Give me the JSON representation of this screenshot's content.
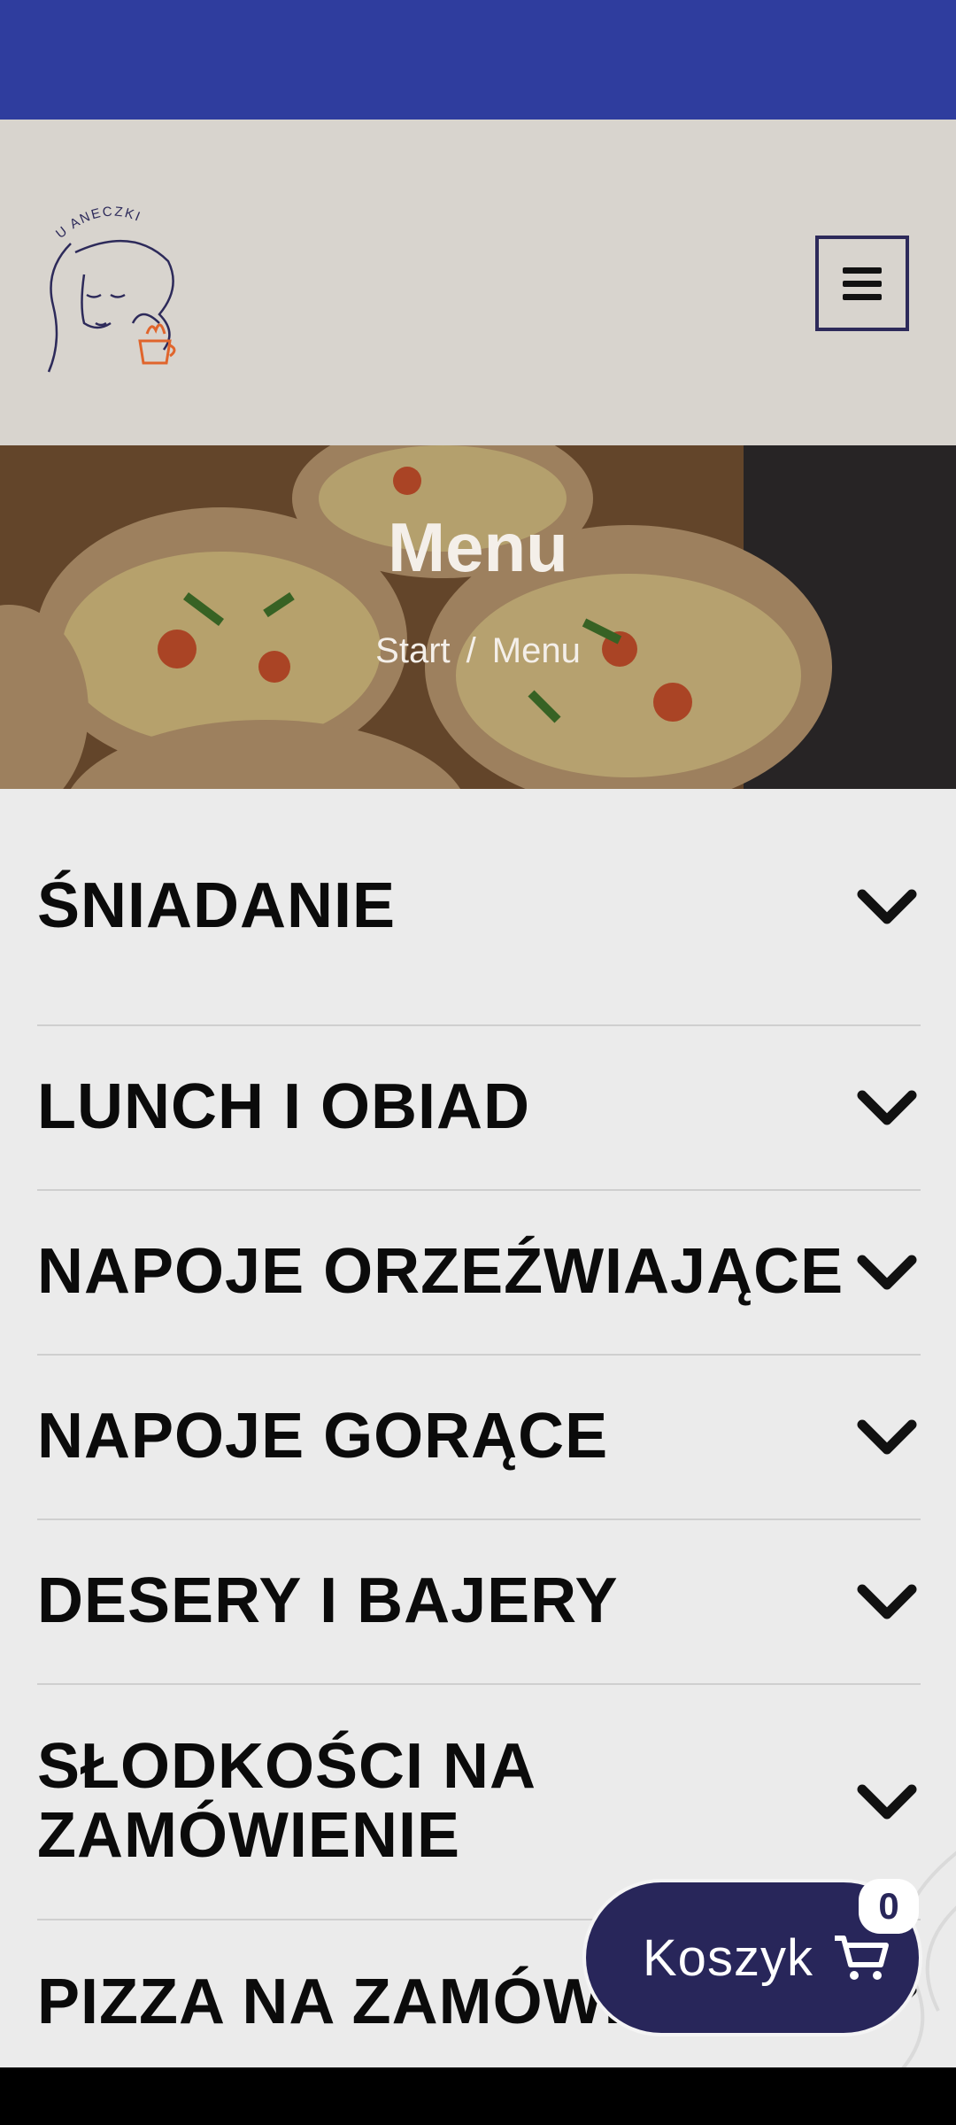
{
  "hero": {
    "title": "Menu"
  },
  "breadcrumb": {
    "start": "Start",
    "separator": "/",
    "current": "Menu"
  },
  "categories": [
    {
      "label": "ŚNIADANIE"
    },
    {
      "label": "LUNCH I OBIAD"
    },
    {
      "label": "NAPOJE ORZEŹWIAJĄCE"
    },
    {
      "label": "NAPOJE GORĄCE"
    },
    {
      "label": "DESERY I BAJERY"
    },
    {
      "label": "SŁODKOŚCI NA ZAMÓWIENIE"
    },
    {
      "label": "PIZZA NA ZAMÓWIENIE"
    }
  ],
  "cart": {
    "label": "Koszyk",
    "count": "0"
  },
  "logo_text": "U ANECZKI",
  "colors": {
    "status_bar": "#2f3d9e",
    "header_bg": "#d8d4ce",
    "cart_bg": "#28265a",
    "content_bg": "#ebebeb"
  },
  "icons": {
    "menu": "hamburger-icon",
    "chevron": "chevron-down-icon",
    "cart": "cart-icon"
  }
}
